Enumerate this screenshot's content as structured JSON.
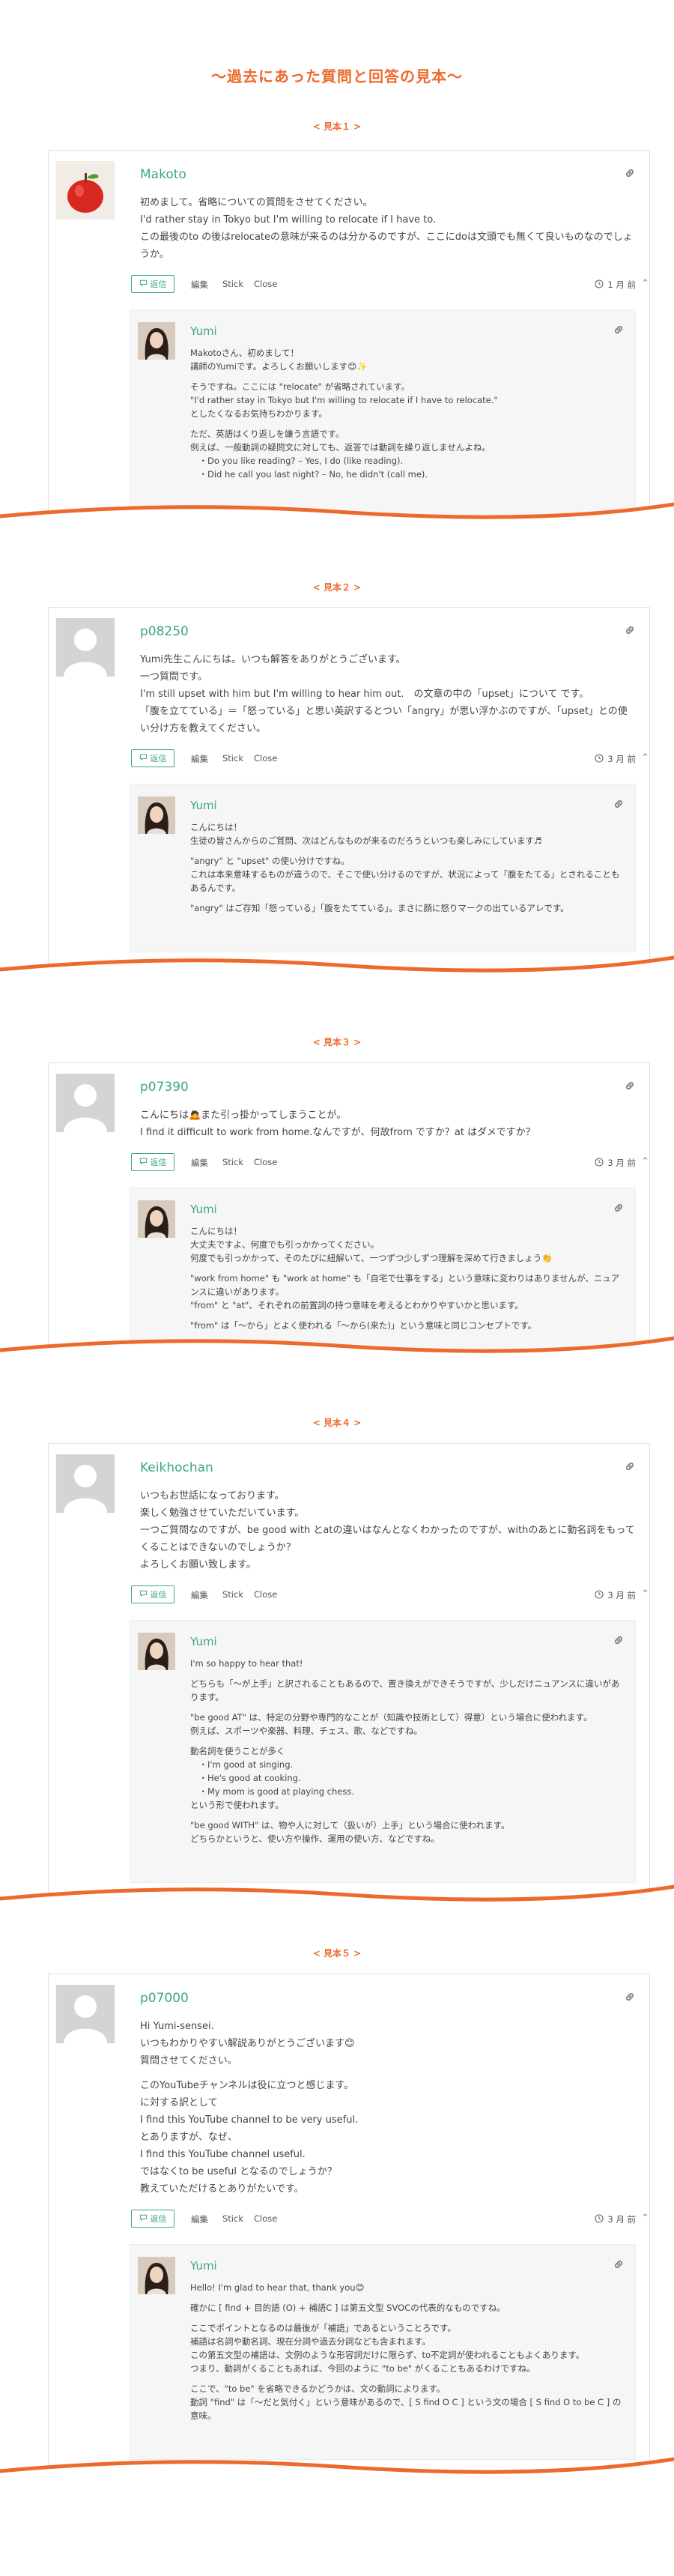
{
  "page_title": "～過去にあった質問と回答の見本～",
  "ui": {
    "reply_label": "返信",
    "edit_label": "編集",
    "stick_label": "Stick",
    "close_label": "Close",
    "replier_name": "Yumi"
  },
  "samples": [
    {
      "label": "< 見本１ >",
      "user": "Makoto",
      "time_ago": "1 月 前",
      "question": [
        "初めまして。省略についての質問をさせてください。",
        "I'd rather stay in Tokyo but I'm willing to relocate if I have to.",
        "この最後のto の後はrelocateの意味が来るのは分かるのですが、ここにdoは文頭でも無くて良いものなのでしょうか。"
      ],
      "answer": [
        "Makotoさん、初めまして！\n講師のYumiです。よろしくお願いします😊✨",
        "そうですね。ここには \"relocate\" が省略されています。\n\"I'd rather stay in Tokyo but I'm willing to relocate if I have to relocate.\"\nとしたくなるお気持ちわかります。",
        "ただ、英語はくり返しを嫌う言語です。\n例えば、一般動詞の疑問文に対しても、返答では動詞を繰り返しませんよね。\n　・Do you like reading? – Yes, I do (like reading).\n　・Did he call you last night? – No, he didn't (call me)."
      ]
    },
    {
      "label": "< 見本２ >",
      "user": "p08250",
      "time_ago": "3 月 前",
      "question": [
        "Yumi先生こんにちは。いつも解答をありがとうございます。",
        "一つ質問です。",
        "I'm still upset with him but I'm willing to hear him out.　の文章の中の「upset」について です。",
        "「腹を立てている」＝「怒っている」と思い英訳するとつい「angry」が思い浮かぶのですが、「upset」との使い分け方を教えてください。"
      ],
      "answer": [
        "こんにちは！\n生徒の皆さんからのご質問、次はどんなものが来るのだろうといつも楽しみにしています♬",
        "\"angry\" と \"upset\" の使い分けですね。\nこれは本来意味するものが違うので、そこで使い分けるのですが、状況によって「腹をたてる」とされることもあるんです。",
        "\"angry\" はご存知「怒っている」「腹をたてている」。まさに顔に怒りマークの出ているアレです。"
      ]
    },
    {
      "label": "< 見本３ >",
      "user": "p07390",
      "time_ago": "3 月 前",
      "question": [
        "こんにちは🙇また引っ掛かってしまうことが。",
        "I find it difficult to work from home.なんですが、何故from ですか？at はダメですか？"
      ],
      "answer": [
        "こんにちは！\n大丈夫ですよ、何度でも引っかかってください。\n何度でも引っかかって、そのたびに紐解いて、一つずつ少しずつ理解を深めて行きましょう👏",
        "\"work from home\" も \"work at home\" も「自宅で仕事をする」という意味に変わりはありませんが、ニュアンスに違いがあります。\n\"from\" と \"at\"、それぞれの前置詞の持つ意味を考えるとわかりやすいかと思います。",
        "\"from\" は「～から」とよく使われる「～から(来た)」という意味と同じコンセプトです。"
      ]
    },
    {
      "label": "< 見本４ >",
      "user": "Keikhochan",
      "time_ago": "3 月 前",
      "question": [
        "いつもお世話になっております。",
        "楽しく勉強させていただいています。",
        "一つご質問なのですが、be good with とatの違いはなんとなくわかったのですが、withのあとに動名詞をもってくることはできないのでしょうか？",
        "よろしくお願い致します。"
      ],
      "answer": [
        "I'm so happy to hear that!",
        "どちらも「～が上手」と訳されることもあるので、置き換えができそうですが、少しだけニュアンスに違いがあります。",
        "\"be good AT\" は、特定の分野や専門的なことが（知識や技術として）得意）という場合に使われます。\n例えば、スポーツや楽器、料理、チェス、歌、などですね。",
        "動名詞を使うことが多く\n　・I'm good at singing.\n　・He's good at cooking.\n　・My mom is good at playing chess.\nという形で使われます。",
        "\"be good WITH\" は、物や人に対して（扱いが）上手」という場合に使われます。\nどちらかというと、使い方や操作、運用の使い方、などですね。"
      ]
    },
    {
      "label": "< 見本５ >",
      "user": "p07000",
      "time_ago": "3 月 前",
      "question": [
        "Hi Yumi-sensei.",
        "いつもわかりやすい解説ありがとうございます😊",
        "質問させてください。",
        "",
        "このYouTubeチャンネルは役に立つと感じます。",
        "に対する訳として",
        "I find this YouTube channel to be very useful.",
        "とありますが、なぜ、",
        "I find this YouTube channel useful.",
        "ではなくto be useful となるのでしょうか？",
        "教えていただけるとありがたいです。"
      ],
      "answer": [
        "Hello! I'm glad to hear that, thank you😊",
        "確かに [ find + 目的語 (O) + 補語C ] は第五文型 SVOCの代表的なものですね。",
        "ここでポイントとなるのは最後が「補語」であるということろです。\n補語は名詞や動名詞、現在分詞や過去分詞なども含まれます。\nこの第五文型の補語は、文例のような形容詞だけに限らず、to不定詞が使われることもよくあります。\nつまり、動詞がくることもあれば、今回のように \"to be\" がくることもあるわけですね。",
        "ここで、\"to be\" を省略できるかどうかは、文の動詞によります。\n動詞 \"find\" は「～だと気付く」という意味があるので、[ S find O C ] という文の場合 [ S find O to be C ] の意味。"
      ]
    }
  ]
}
